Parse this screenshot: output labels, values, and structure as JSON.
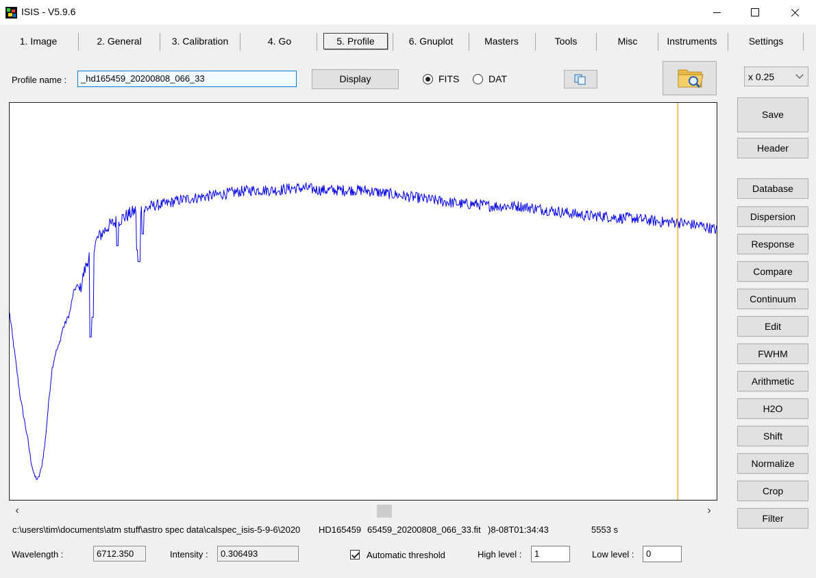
{
  "window": {
    "title": "ISIS - V5.9.6",
    "controls": {
      "minimize": "minimize",
      "maximize": "maximize",
      "close": "close"
    }
  },
  "tabs": [
    {
      "label": "1. Image"
    },
    {
      "label": "2. General"
    },
    {
      "label": "3. Calibration"
    },
    {
      "label": "4. Go"
    },
    {
      "label": "5. Profile",
      "selected": true
    },
    {
      "label": "6. Gnuplot"
    },
    {
      "label": "Masters"
    },
    {
      "label": "Tools"
    },
    {
      "label": "Misc"
    },
    {
      "label": "Instruments"
    },
    {
      "label": "Settings"
    }
  ],
  "profile": {
    "name_label": "Profile name :",
    "name_value": "_hd165459_20200808_066_33",
    "display_button": "Display",
    "format_options": [
      "FITS",
      "DAT"
    ],
    "format_selected": "FITS"
  },
  "zoom": {
    "value": "x 0.25"
  },
  "right_buttons": {
    "save": "Save",
    "header": "Header",
    "tools": [
      "Database",
      "Dispersion",
      "Response",
      "Compare",
      "Continuum",
      "Edit",
      "FWHM",
      "Arithmetic",
      "H2O",
      "Shift",
      "Normalize",
      "Crop",
      "Filter"
    ]
  },
  "status": {
    "path": "c:\\users\\tim\\documents\\atm stuff\\astro spec data\\calspec_isis-5-9-6\\2020",
    "object": "HD165459",
    "file": "65459_20200808_066_33.fit",
    "date": ")8-08T01:34:43",
    "exposure": "5553 s"
  },
  "readouts": {
    "wavelength_label": "Wavelength :",
    "wavelength_value": "6712.350",
    "intensity_label": "Intensity :",
    "intensity_value": "0.306493",
    "auto_threshold_label": "Automatic threshold",
    "auto_threshold_checked": true,
    "high_label": "High level :",
    "high_value": "1",
    "low_label": "Low level :",
    "low_value": "0"
  },
  "colors": {
    "spectrum": "#0000e6",
    "cursor": "#e8a317"
  },
  "chart_data": {
    "type": "line",
    "x_range_fraction": [
      0,
      1
    ],
    "y_range_fraction": [
      0,
      1
    ],
    "cursor_x_fraction": 0.945,
    "profile_fraction": [
      [
        0.0,
        0.47
      ],
      [
        0.005,
        0.4
      ],
      [
        0.01,
        0.33
      ],
      [
        0.015,
        0.26
      ],
      [
        0.02,
        0.21
      ],
      [
        0.025,
        0.16
      ],
      [
        0.03,
        0.1
      ],
      [
        0.035,
        0.06
      ],
      [
        0.04,
        0.05
      ],
      [
        0.045,
        0.08
      ],
      [
        0.05,
        0.14
      ],
      [
        0.055,
        0.24
      ],
      [
        0.06,
        0.33
      ],
      [
        0.065,
        0.37
      ],
      [
        0.07,
        0.39
      ],
      [
        0.075,
        0.43
      ],
      [
        0.08,
        0.45
      ],
      [
        0.085,
        0.47
      ],
      [
        0.09,
        0.52
      ],
      [
        0.095,
        0.54
      ],
      [
        0.1,
        0.53
      ],
      [
        0.105,
        0.57
      ],
      [
        0.11,
        0.6
      ],
      [
        0.115,
        0.63
      ],
      [
        0.12,
        0.64
      ],
      [
        0.125,
        0.66
      ],
      [
        0.13,
        0.67
      ],
      [
        0.135,
        0.68
      ],
      [
        0.14,
        0.69
      ],
      [
        0.15,
        0.7
      ],
      [
        0.16,
        0.71
      ],
      [
        0.17,
        0.72
      ],
      [
        0.18,
        0.73
      ],
      [
        0.19,
        0.73
      ],
      [
        0.2,
        0.74
      ],
      [
        0.22,
        0.745
      ],
      [
        0.24,
        0.755
      ],
      [
        0.26,
        0.76
      ],
      [
        0.28,
        0.765
      ],
      [
        0.3,
        0.77
      ],
      [
        0.32,
        0.775
      ],
      [
        0.34,
        0.78
      ],
      [
        0.36,
        0.78
      ],
      [
        0.38,
        0.78
      ],
      [
        0.4,
        0.785
      ],
      [
        0.42,
        0.785
      ],
      [
        0.44,
        0.78
      ],
      [
        0.46,
        0.78
      ],
      [
        0.48,
        0.78
      ],
      [
        0.5,
        0.78
      ],
      [
        0.52,
        0.775
      ],
      [
        0.54,
        0.77
      ],
      [
        0.56,
        0.765
      ],
      [
        0.58,
        0.76
      ],
      [
        0.6,
        0.755
      ],
      [
        0.62,
        0.75
      ],
      [
        0.64,
        0.745
      ],
      [
        0.66,
        0.745
      ],
      [
        0.68,
        0.74
      ],
      [
        0.7,
        0.74
      ],
      [
        0.72,
        0.74
      ],
      [
        0.74,
        0.735
      ],
      [
        0.76,
        0.73
      ],
      [
        0.78,
        0.725
      ],
      [
        0.8,
        0.72
      ],
      [
        0.82,
        0.715
      ],
      [
        0.84,
        0.715
      ],
      [
        0.86,
        0.71
      ],
      [
        0.88,
        0.71
      ],
      [
        0.9,
        0.705
      ],
      [
        0.92,
        0.7
      ],
      [
        0.94,
        0.7
      ],
      [
        0.96,
        0.695
      ],
      [
        0.98,
        0.69
      ],
      [
        1.0,
        0.68
      ]
    ],
    "absorption_dips_fraction": [
      [
        0.115,
        0.41
      ],
      [
        0.117,
        0.46
      ],
      [
        0.181,
        0.63
      ],
      [
        0.183,
        0.6
      ],
      [
        0.188,
        0.67
      ],
      [
        0.152,
        0.64
      ]
    ]
  }
}
